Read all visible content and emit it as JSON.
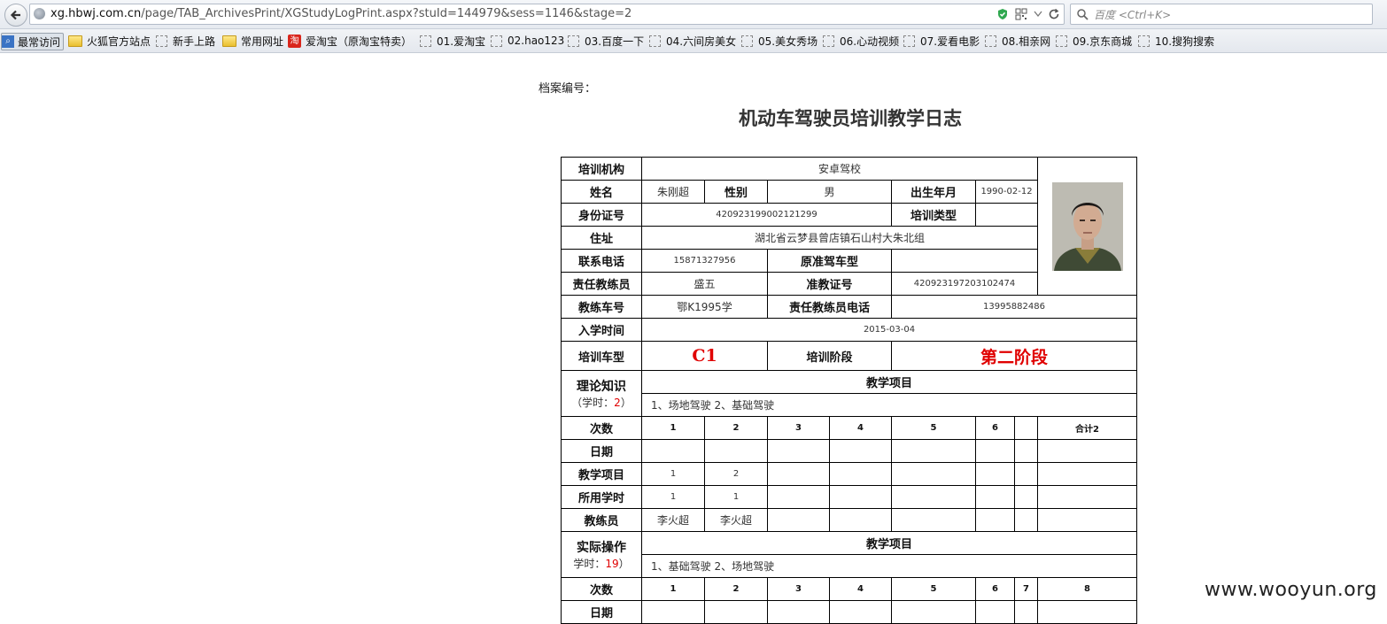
{
  "browser": {
    "url_host": "xg.hbwj.com.cn",
    "url_path": "/page/TAB_ArchivesPrint/XGStudyLogPrint.aspx?stuId=144979&sess=1146&stage=2",
    "search_placeholder": "百度 <Ctrl+K>",
    "bookmarks": [
      "最常访问",
      "火狐官方站点",
      "新手上路",
      "常用网址",
      "爱淘宝（原淘宝特卖）",
      "01.爱淘宝",
      "02.hao123",
      "03.百度一下",
      "04.六间房美女",
      "05.美女秀场",
      "06.心动视频",
      "07.爱看电影",
      "08.相亲网",
      "09.京东商城",
      "10.搜狗搜索"
    ]
  },
  "page": {
    "archive_label": "档案编号：",
    "title": "机动车驾驶员培训教学日志",
    "watermark": "www.wooyun.org"
  },
  "info": {
    "org_label": "培训机构",
    "org": "安卓驾校",
    "name_label": "姓名",
    "name": "朱刚超",
    "gender_label": "性别",
    "gender": "男",
    "birth_label": "出生年月",
    "birth": "1990-02-12",
    "id_label": "身份证号",
    "id": "420923199002121299",
    "train_type_label": "培训类型",
    "train_type": "",
    "address_label": "住址",
    "address": "湖北省云梦县曾店镇石山村大朱北组",
    "phone_label": "联系电话",
    "phone": "15871327956",
    "orig_license_label": "原准驾车型",
    "orig_license": "",
    "coach_label": "责任教练员",
    "coach": "盛五",
    "coach_cert_label": "准教证号",
    "coach_cert": "420923197203102474",
    "car_no_label": "教练车号",
    "car_no": "鄂K1995学",
    "coach_phone_label": "责任教练员电话",
    "coach_phone": "13995882486",
    "enroll_label": "入学时间",
    "enroll": "2015-03-04",
    "vehicle_label": "培训车型",
    "vehicle": "C1",
    "stage_label": "培训阶段",
    "stage": "第二阶段"
  },
  "theory": {
    "title": "理论知识",
    "hours_prefix": "（学时：",
    "hours": "2",
    "hours_suffix": "）",
    "items_header": "教学项目",
    "items": "1、场地驾驶 2、基础驾驶",
    "row_labels": [
      "次数",
      "日期",
      "教学项目",
      "所用学时",
      "教练员"
    ],
    "counts": [
      "1",
      "2",
      "3",
      "4",
      "5",
      "6",
      "",
      "合计2"
    ],
    "dates": [
      "",
      "",
      "",
      "",
      "",
      "",
      "",
      ""
    ],
    "projects": [
      "1",
      "2",
      "",
      "",
      "",
      "",
      "",
      ""
    ],
    "hours_used": [
      "1",
      "1",
      "",
      "",
      "",
      "",
      "",
      ""
    ],
    "coaches": [
      "李火超",
      "李火超",
      "",
      "",
      "",
      "",
      "",
      ""
    ]
  },
  "practice": {
    "title": "实际操作",
    "hours_prefix": "学时：",
    "hours": "19",
    "hours_suffix": "）",
    "items_header": "教学项目",
    "items": "1、基础驾驶 2、场地驾驶",
    "row_labels": [
      "次数",
      "日期"
    ],
    "counts": [
      "1",
      "2",
      "3",
      "4",
      "5",
      "6",
      "7",
      "8"
    ],
    "dates": [
      "",
      "",
      "",
      "",
      "",
      "",
      "",
      ""
    ]
  }
}
